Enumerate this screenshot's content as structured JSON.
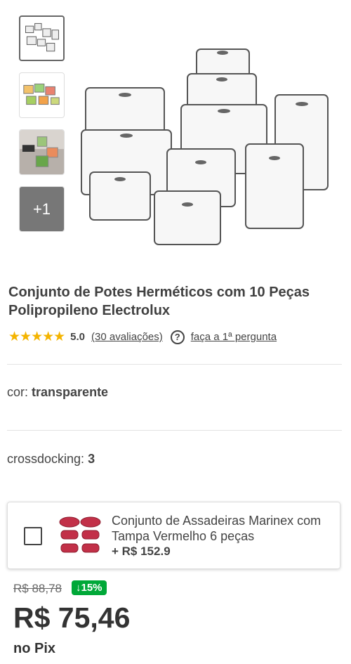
{
  "product": {
    "title": "Conjunto de Potes Herméticos com 10 Peças Polipropileno Electrolux",
    "stars": "★★★★★",
    "rating": "5.0",
    "reviews_link": "(30 avaliações)",
    "question_link": "faça a 1ª pergunta"
  },
  "gallery": {
    "more_label": "+1"
  },
  "attributes": [
    {
      "label": "cor:",
      "value": "transparente"
    },
    {
      "label": "crossdocking:",
      "value": "3"
    }
  ],
  "bundle": {
    "name": "Conjunto de Assadeiras Marinex com Tampa Vermelho 6 peças",
    "price": "+ R$ 152.9"
  },
  "pricing": {
    "old_price": "R$ 88,78",
    "discount": "↓15%",
    "price": "R$ 75,46",
    "payment": "no Pix"
  }
}
